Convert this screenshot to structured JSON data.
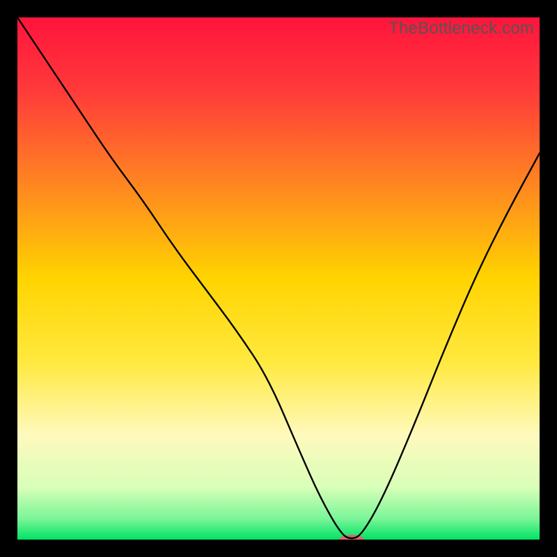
{
  "watermark": "TheBottleneck.com",
  "chart_data": {
    "type": "line",
    "title": "",
    "xlabel": "",
    "ylabel": "",
    "xlim": [
      0,
      100
    ],
    "ylim": [
      0,
      100
    ],
    "grid": false,
    "legend": false,
    "background_gradient_stops": [
      {
        "offset": 0.0,
        "color": "#ff143c"
      },
      {
        "offset": 0.14,
        "color": "#ff3a3a"
      },
      {
        "offset": 0.33,
        "color": "#ff8a1f"
      },
      {
        "offset": 0.5,
        "color": "#ffd400"
      },
      {
        "offset": 0.66,
        "color": "#ffe93f"
      },
      {
        "offset": 0.8,
        "color": "#fff9bd"
      },
      {
        "offset": 0.9,
        "color": "#d8ffb8"
      },
      {
        "offset": 0.96,
        "color": "#7af598"
      },
      {
        "offset": 1.0,
        "color": "#00e364"
      }
    ],
    "series": [
      {
        "name": "bottleneck-curve",
        "stroke": "#000000",
        "stroke_width": 2.4,
        "x": [
          0,
          6,
          12,
          18,
          24,
          30,
          36,
          42,
          48,
          54,
          58,
          62,
          64,
          66,
          70,
          76,
          82,
          88,
          94,
          100
        ],
        "y": [
          100,
          91,
          82,
          73,
          65,
          56,
          48,
          40,
          31,
          17,
          8,
          1,
          0,
          1,
          8,
          22,
          37,
          51,
          63,
          74
        ]
      }
    ],
    "marker": {
      "name": "optimal-marker",
      "x": 64,
      "y": 0,
      "color": "#d46a6a",
      "rx": 18,
      "ry": 7
    }
  }
}
